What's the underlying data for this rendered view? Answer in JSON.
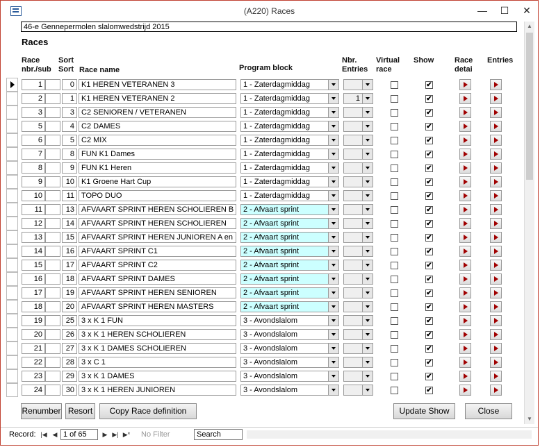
{
  "window": {
    "title": "(A220) Races",
    "minimize": "—",
    "maximize": "☐",
    "close": "✕"
  },
  "event_name": "46-e Gennepermolen slalomwedstrijd 2015",
  "form_title": "Races",
  "columns": {
    "race_nbr": "Race nbr./sub",
    "sort": "Sort Sort",
    "race_name": "Race name",
    "program_block": "Program block",
    "nbr_entries": "Nbr. Entries",
    "virtual_race": "Virtual race",
    "show": "Show",
    "race_detail": "Race detai",
    "entries": "Entries"
  },
  "rows": [
    {
      "nbr": "1",
      "sub": "",
      "sort": "0",
      "name": "K1  HEREN VETERANEN 3",
      "block": "1 - Zaterdagmiddag",
      "entries": "",
      "virtual": false,
      "show": true
    },
    {
      "nbr": "2",
      "sub": "",
      "sort": "1",
      "name": "K1  HEREN VETERANEN  2",
      "block": "1 - Zaterdagmiddag",
      "entries": "1",
      "virtual": false,
      "show": true
    },
    {
      "nbr": "3",
      "sub": "",
      "sort": "3",
      "name": "C2  SENIOREN / VETERANEN",
      "block": "1 - Zaterdagmiddag",
      "entries": "",
      "virtual": false,
      "show": true
    },
    {
      "nbr": "5",
      "sub": "",
      "sort": "4",
      "name": "C2  DAMES",
      "block": "1 - Zaterdagmiddag",
      "entries": "",
      "virtual": false,
      "show": true
    },
    {
      "nbr": "6",
      "sub": "",
      "sort": "5",
      "name": "C2  MIX",
      "block": "1 - Zaterdagmiddag",
      "entries": "",
      "virtual": false,
      "show": true
    },
    {
      "nbr": "7",
      "sub": "",
      "sort": "8",
      "name": "FUN K1 Dames",
      "block": "1 - Zaterdagmiddag",
      "entries": "",
      "virtual": false,
      "show": true
    },
    {
      "nbr": "8",
      "sub": "",
      "sort": "9",
      "name": "FUN K1 Heren",
      "block": "1 - Zaterdagmiddag",
      "entries": "",
      "virtual": false,
      "show": true
    },
    {
      "nbr": "9",
      "sub": "",
      "sort": "10",
      "name": "K1 Groene Hart Cup",
      "block": "1 - Zaterdagmiddag",
      "entries": "",
      "virtual": false,
      "show": true
    },
    {
      "nbr": "10",
      "sub": "",
      "sort": "11",
      "name": "TOPO DUO",
      "block": "1 - Zaterdagmiddag",
      "entries": "",
      "virtual": false,
      "show": true
    },
    {
      "nbr": "11",
      "sub": "",
      "sort": "13",
      "name": "AFVAART SPRINT HEREN SCHOLIEREN B",
      "block": "2 - Afvaart sprint",
      "entries": "",
      "virtual": false,
      "show": true
    },
    {
      "nbr": "12",
      "sub": "",
      "sort": "14",
      "name": "AFVAART SPRINT  HEREN SCHOLIEREN",
      "block": "2 - Afvaart sprint",
      "entries": "",
      "virtual": false,
      "show": true
    },
    {
      "nbr": "13",
      "sub": "",
      "sort": "15",
      "name": "AFVAART SPRINT HEREN JUNIOREN A en B",
      "block": "2 - Afvaart sprint",
      "entries": "",
      "virtual": false,
      "show": true
    },
    {
      "nbr": "14",
      "sub": "",
      "sort": "16",
      "name": "AFVAART SPRINT C1",
      "block": "2 - Afvaart sprint",
      "entries": "",
      "virtual": false,
      "show": true
    },
    {
      "nbr": "15",
      "sub": "",
      "sort": "17",
      "name": "AFVAART SPRINT C2",
      "block": "2 - Afvaart sprint",
      "entries": "",
      "virtual": false,
      "show": true
    },
    {
      "nbr": "16",
      "sub": "",
      "sort": "18",
      "name": "AFVAART SPRINT DAMES",
      "block": "2 - Afvaart sprint",
      "entries": "",
      "virtual": false,
      "show": true
    },
    {
      "nbr": "17",
      "sub": "",
      "sort": "19",
      "name": "AFVAART SPRINT HEREN SENIOREN",
      "block": "2 - Afvaart sprint",
      "entries": "",
      "virtual": false,
      "show": true
    },
    {
      "nbr": "18",
      "sub": "",
      "sort": "20",
      "name": "AFVAART SPRINT HEREN MASTERS",
      "block": "2 - Afvaart sprint",
      "entries": "",
      "virtual": false,
      "show": true
    },
    {
      "nbr": "19",
      "sub": "",
      "sort": "25",
      "name": "3 x K 1  FUN",
      "block": "3 - Avondslalom",
      "entries": "",
      "virtual": false,
      "show": true
    },
    {
      "nbr": "20",
      "sub": "",
      "sort": "26",
      "name": "3 x K 1  HEREN SCHOLIEREN",
      "block": "3 - Avondslalom",
      "entries": "",
      "virtual": false,
      "show": true
    },
    {
      "nbr": "21",
      "sub": "",
      "sort": "27",
      "name": "3 x K 1  DAMES SCHOLIEREN",
      "block": "3 - Avondslalom",
      "entries": "",
      "virtual": false,
      "show": true
    },
    {
      "nbr": "22",
      "sub": "",
      "sort": "28",
      "name": "3 x C 1",
      "block": "3 - Avondslalom",
      "entries": "",
      "virtual": false,
      "show": true
    },
    {
      "nbr": "23",
      "sub": "",
      "sort": "29",
      "name": "3 x K 1  DAMES",
      "block": "3 - Avondslalom",
      "entries": "",
      "virtual": false,
      "show": true
    },
    {
      "nbr": "24",
      "sub": "",
      "sort": "30",
      "name": "3 x K 1 HEREN  JUNIOREN",
      "block": "3 - Avondslalom",
      "entries": "",
      "virtual": false,
      "show": true
    }
  ],
  "buttons": {
    "renumber": "Renumber",
    "resort": "Resort",
    "copy": "Copy Race definition",
    "update_show": "Update Show",
    "close": "Close"
  },
  "navigation": {
    "record_label": "Record:",
    "record_value": "1 of 65",
    "filter_label": "No Filter",
    "search_placeholder": "Search"
  },
  "colors": {
    "cyan_block": "#ccffff",
    "accent_arrow": "#a00000"
  }
}
